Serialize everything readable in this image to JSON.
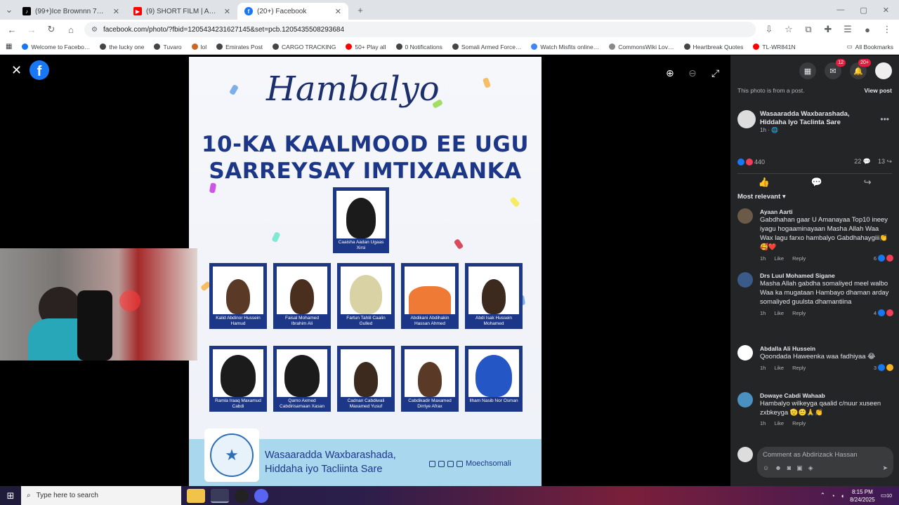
{
  "browser": {
    "tabs": [
      {
        "title": "(99+)Ice Brownnn 7🐱❤ (@i…",
        "color": "#000000",
        "icon": "tiktok-icon"
      },
      {
        "title": "(9) SHORT FILM | ABAAL LOOM…",
        "color": "#ff0000",
        "icon": "youtube-icon"
      },
      {
        "title": "(20+) Facebook",
        "color": "#1877f2",
        "icon": "facebook-icon"
      }
    ],
    "url": "facebook.com/photo/?fbid=1205434231627145&set=pcb.1205435508293684",
    "bookmarks": [
      "Welcome to Facebo…",
      "the lucky one",
      "Tuvaro",
      "lol",
      "Emirates Post",
      "CARGO TRACKING",
      "50+ Play all",
      "0 Notifications",
      "Somali Armed Force…",
      "Watch Misfits online…",
      "CommonsWiki Lov…",
      "Heartbreak Quotes",
      "TL-WR841N"
    ],
    "all_bookmarks": "All Bookmarks"
  },
  "poster": {
    "script_title": "Hambalyo",
    "headline_line1": "10-KA KAALMOOD EE UGU",
    "headline_line2": "SARREYSAY IMTIXAANKA",
    "top_student": "Caaisha Aadan Ugaas Xirsi",
    "row1": [
      "Kalid Abdinor Hussein Hamud",
      "Faisal Mohamed Ibrahim Ali",
      "Fartun Tahlil Caalin Gulled",
      "Abdikani Abdihakin Hassan Ahmed",
      "Abdi Isak Hussein Mohamed"
    ],
    "row2": [
      "Ramla Iraaq Maxamud Cabdi",
      "Qamo Axmed Cabdirisamaan Xasan",
      "Cadnan Cabdiwali Maxamed Yusuf",
      "Cabdikadir Maxamed Dirriye Afrax",
      "Ilham Nasib Nor Osman"
    ],
    "ministry_line1": "Wasaaradda Waxbarashada,",
    "ministry_line2": "Hiddaha iyo Tacliinta Sare",
    "handle": "Moechsomali"
  },
  "panel": {
    "note": "This photo is from a post.",
    "view_post": "View post",
    "author": "Wasaaradda Waxbarashada, Hiddaha Iyo Taclinta Sare",
    "time": "1h · 🌐",
    "reactions": "440",
    "comments_count": "22",
    "shares_count": "13",
    "sort_label": "Most relevant",
    "notification_badge": "20+",
    "messenger_badge": "12",
    "comments": [
      {
        "name": "Ayaan Aarti",
        "text": "Gabdhahan gaar U Amanayaa Top10 ineey iyagu hogaaminayaan Masha Allah Waa Wax lagu farxo hambalyo Gabdhahaygiii👏🥰❤️",
        "time": "1h",
        "count": "6",
        "like": "Like",
        "reply": "Reply",
        "avatar": "#6b5a48"
      },
      {
        "name": "Drs Luul Mohamed Sigane",
        "text": "Masha Allah gabdha somaliyed meel walbo Waa ka mugataan Hambayo dhaman arday somaliyed guulsta dhamantiina",
        "time": "1h",
        "count": "4",
        "like": "Like",
        "reply": "Reply",
        "avatar": "#3a5a8a"
      },
      {
        "name": "Abdalla Ali Hussein",
        "text": "Qoondada Haweenka waa fadhiyaa 😂",
        "time": "1h",
        "count": "3",
        "like": "Like",
        "reply": "Reply",
        "avatar": "#ffffff"
      },
      {
        "name": "Dowaye Cabdi Wahaab",
        "text": "Hambalyo wilkeyga qaalid c/nuur xuseen zxbkeyga 🫡🙂🙏👏",
        "time": "1h",
        "count": "",
        "like": "Like",
        "reply": "Reply",
        "avatar": "#4a90c0"
      }
    ],
    "composer_placeholder": "Comment as Abdirizack Hassan"
  },
  "taskbar": {
    "search_placeholder": "Type here to search",
    "time": "8:15 PM",
    "date": "8/24/2025",
    "notif_count": "10"
  }
}
